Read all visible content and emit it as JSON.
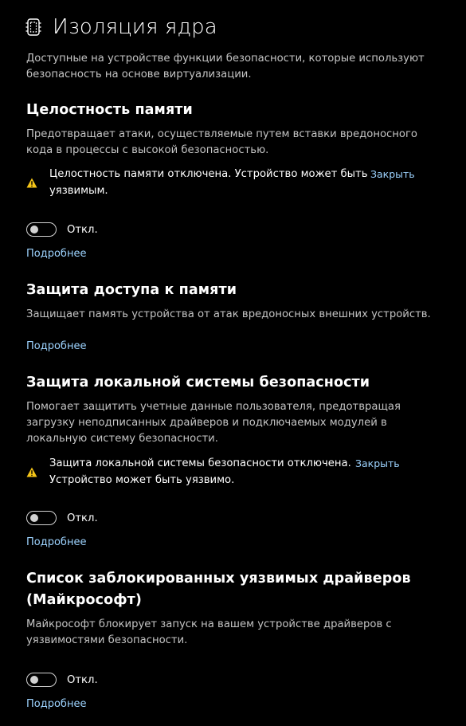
{
  "page": {
    "title": "Изоляция ядра",
    "description": "Доступные на устройстве функции безопасности, которые используют безопасность на основе виртуализации."
  },
  "memory_integrity": {
    "title": "Целостность памяти",
    "description": "Предотвращает атаки, осуществляемые путем вставки вредоносного кода в процессы с высокой безопасностью.",
    "warning": "Целостность памяти отключена. Устройство может быть уязвимым.",
    "dismiss": "Закрыть",
    "toggle_state": "Откл.",
    "toggle_on": false,
    "learn_more": "Подробнее"
  },
  "memory_access_protection": {
    "title": "Защита доступа к памяти",
    "description": "Защищает память устройства от атак вредоносных внешних устройств.",
    "learn_more": "Подробнее"
  },
  "lsa_protection": {
    "title": "Защита локальной системы безопасности",
    "description": "Помогает защитить учетные данные пользователя, предотвращая загрузку неподписанных драйверов и подключаемых модулей в локальную систему безопасности.",
    "warning": "Защита локальной системы безопасности отключена. Устройство может быть уязвимо.",
    "dismiss": "Закрыть",
    "toggle_state": "Откл.",
    "toggle_on": false,
    "learn_more": "Подробнее"
  },
  "vulnerable_driver_blocklist": {
    "title": "Список заблокированных уязвимых драйверов (Майкрософт)",
    "description": "Майкрософт блокирует запуск на вашем устройстве драйверов с уязвимостями безопасности.",
    "toggle_state": "Откл.",
    "toggle_on": false,
    "learn_more": "Подробнее"
  },
  "colors": {
    "background": "#000000",
    "accent_link": "#9dd3ff",
    "warning_icon": "#f5c518",
    "secondary_text": "#c4c4c4"
  },
  "icons": {
    "header": "core-isolation-chip-icon",
    "warning": "warning-triangle-icon"
  }
}
